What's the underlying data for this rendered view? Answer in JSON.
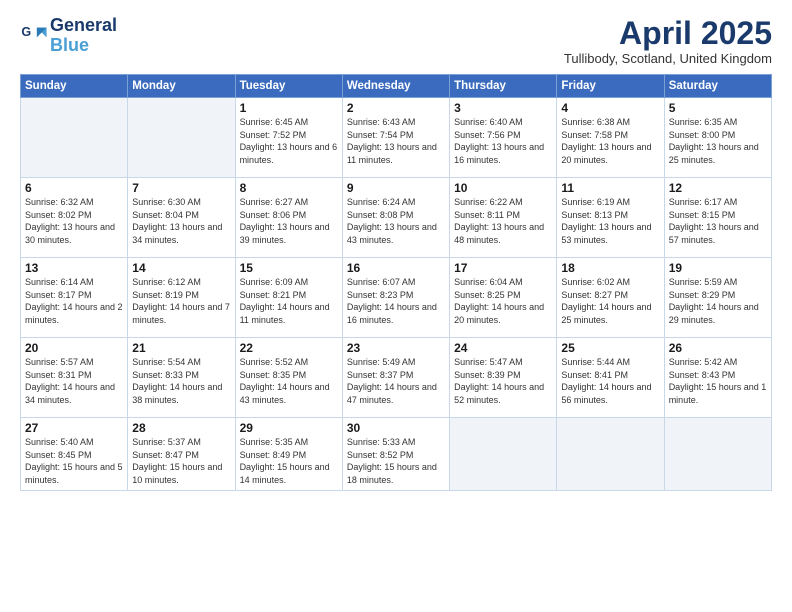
{
  "header": {
    "logo_line1": "General",
    "logo_line2": "Blue",
    "month_title": "April 2025",
    "location": "Tullibody, Scotland, United Kingdom"
  },
  "weekdays": [
    "Sunday",
    "Monday",
    "Tuesday",
    "Wednesday",
    "Thursday",
    "Friday",
    "Saturday"
  ],
  "weeks": [
    [
      {
        "day": "",
        "info": ""
      },
      {
        "day": "",
        "info": ""
      },
      {
        "day": "1",
        "info": "Sunrise: 6:45 AM\nSunset: 7:52 PM\nDaylight: 13 hours and 6 minutes."
      },
      {
        "day": "2",
        "info": "Sunrise: 6:43 AM\nSunset: 7:54 PM\nDaylight: 13 hours and 11 minutes."
      },
      {
        "day": "3",
        "info": "Sunrise: 6:40 AM\nSunset: 7:56 PM\nDaylight: 13 hours and 16 minutes."
      },
      {
        "day": "4",
        "info": "Sunrise: 6:38 AM\nSunset: 7:58 PM\nDaylight: 13 hours and 20 minutes."
      },
      {
        "day": "5",
        "info": "Sunrise: 6:35 AM\nSunset: 8:00 PM\nDaylight: 13 hours and 25 minutes."
      }
    ],
    [
      {
        "day": "6",
        "info": "Sunrise: 6:32 AM\nSunset: 8:02 PM\nDaylight: 13 hours and 30 minutes."
      },
      {
        "day": "7",
        "info": "Sunrise: 6:30 AM\nSunset: 8:04 PM\nDaylight: 13 hours and 34 minutes."
      },
      {
        "day": "8",
        "info": "Sunrise: 6:27 AM\nSunset: 8:06 PM\nDaylight: 13 hours and 39 minutes."
      },
      {
        "day": "9",
        "info": "Sunrise: 6:24 AM\nSunset: 8:08 PM\nDaylight: 13 hours and 43 minutes."
      },
      {
        "day": "10",
        "info": "Sunrise: 6:22 AM\nSunset: 8:11 PM\nDaylight: 13 hours and 48 minutes."
      },
      {
        "day": "11",
        "info": "Sunrise: 6:19 AM\nSunset: 8:13 PM\nDaylight: 13 hours and 53 minutes."
      },
      {
        "day": "12",
        "info": "Sunrise: 6:17 AM\nSunset: 8:15 PM\nDaylight: 13 hours and 57 minutes."
      }
    ],
    [
      {
        "day": "13",
        "info": "Sunrise: 6:14 AM\nSunset: 8:17 PM\nDaylight: 14 hours and 2 minutes."
      },
      {
        "day": "14",
        "info": "Sunrise: 6:12 AM\nSunset: 8:19 PM\nDaylight: 14 hours and 7 minutes."
      },
      {
        "day": "15",
        "info": "Sunrise: 6:09 AM\nSunset: 8:21 PM\nDaylight: 14 hours and 11 minutes."
      },
      {
        "day": "16",
        "info": "Sunrise: 6:07 AM\nSunset: 8:23 PM\nDaylight: 14 hours and 16 minutes."
      },
      {
        "day": "17",
        "info": "Sunrise: 6:04 AM\nSunset: 8:25 PM\nDaylight: 14 hours and 20 minutes."
      },
      {
        "day": "18",
        "info": "Sunrise: 6:02 AM\nSunset: 8:27 PM\nDaylight: 14 hours and 25 minutes."
      },
      {
        "day": "19",
        "info": "Sunrise: 5:59 AM\nSunset: 8:29 PM\nDaylight: 14 hours and 29 minutes."
      }
    ],
    [
      {
        "day": "20",
        "info": "Sunrise: 5:57 AM\nSunset: 8:31 PM\nDaylight: 14 hours and 34 minutes."
      },
      {
        "day": "21",
        "info": "Sunrise: 5:54 AM\nSunset: 8:33 PM\nDaylight: 14 hours and 38 minutes."
      },
      {
        "day": "22",
        "info": "Sunrise: 5:52 AM\nSunset: 8:35 PM\nDaylight: 14 hours and 43 minutes."
      },
      {
        "day": "23",
        "info": "Sunrise: 5:49 AM\nSunset: 8:37 PM\nDaylight: 14 hours and 47 minutes."
      },
      {
        "day": "24",
        "info": "Sunrise: 5:47 AM\nSunset: 8:39 PM\nDaylight: 14 hours and 52 minutes."
      },
      {
        "day": "25",
        "info": "Sunrise: 5:44 AM\nSunset: 8:41 PM\nDaylight: 14 hours and 56 minutes."
      },
      {
        "day": "26",
        "info": "Sunrise: 5:42 AM\nSunset: 8:43 PM\nDaylight: 15 hours and 1 minute."
      }
    ],
    [
      {
        "day": "27",
        "info": "Sunrise: 5:40 AM\nSunset: 8:45 PM\nDaylight: 15 hours and 5 minutes."
      },
      {
        "day": "28",
        "info": "Sunrise: 5:37 AM\nSunset: 8:47 PM\nDaylight: 15 hours and 10 minutes."
      },
      {
        "day": "29",
        "info": "Sunrise: 5:35 AM\nSunset: 8:49 PM\nDaylight: 15 hours and 14 minutes."
      },
      {
        "day": "30",
        "info": "Sunrise: 5:33 AM\nSunset: 8:52 PM\nDaylight: 15 hours and 18 minutes."
      },
      {
        "day": "",
        "info": ""
      },
      {
        "day": "",
        "info": ""
      },
      {
        "day": "",
        "info": ""
      }
    ]
  ]
}
